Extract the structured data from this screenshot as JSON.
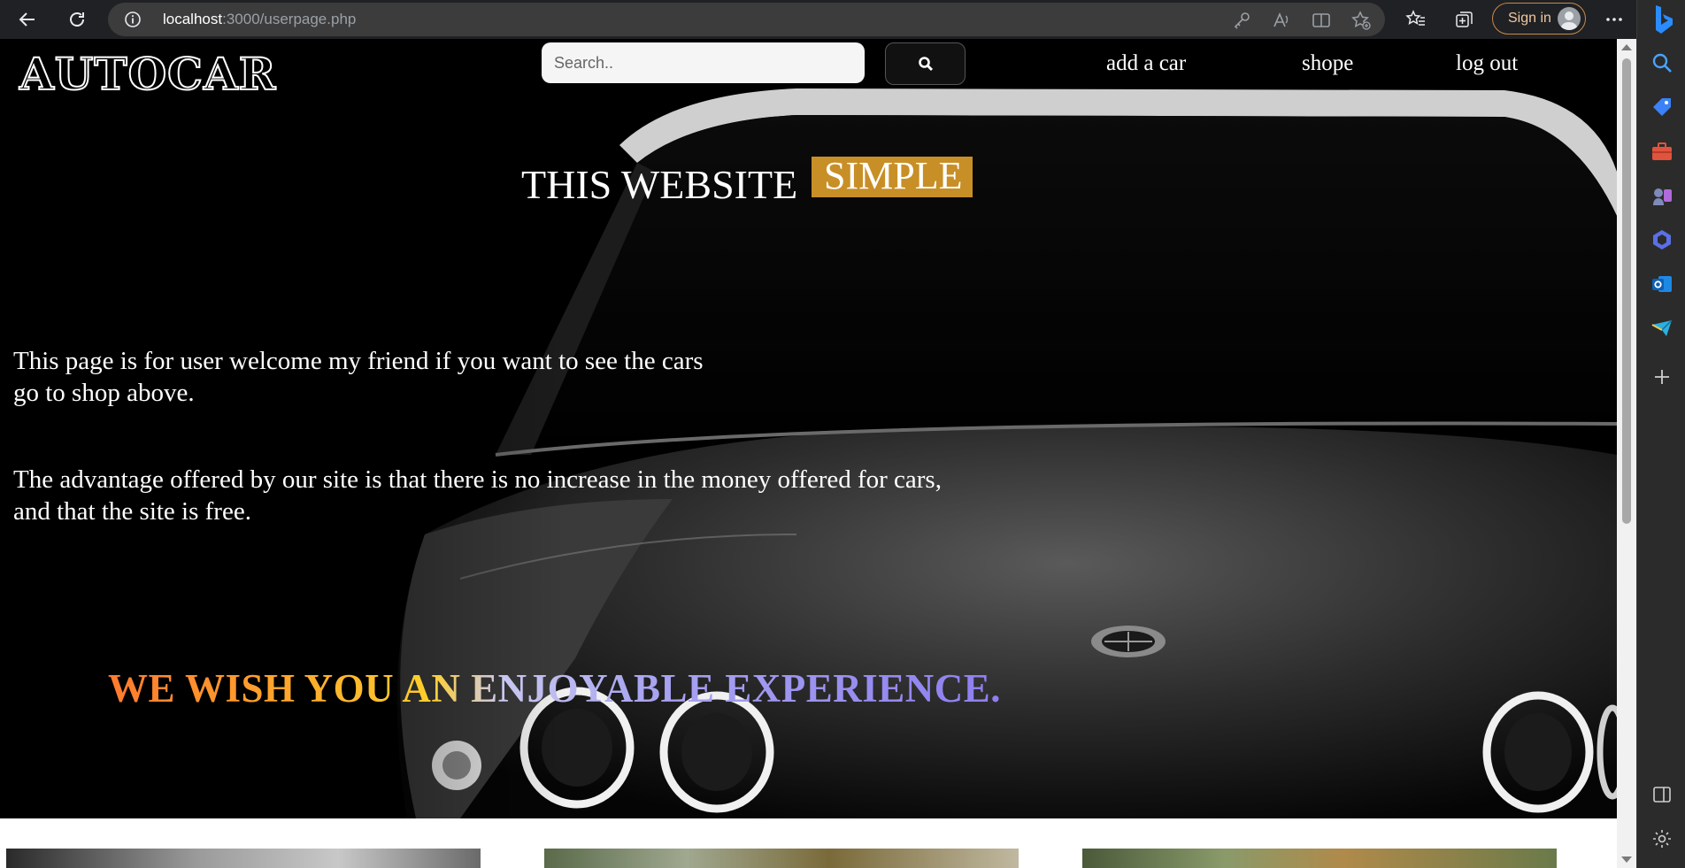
{
  "browser": {
    "url_host": "localhost",
    "url_path": ":3000/userpage.php",
    "signin_label": "Sign in"
  },
  "site": {
    "logo": "AUTOCAR",
    "search_placeholder": "Search..",
    "nav": [
      "add a car",
      "shope",
      "log out"
    ]
  },
  "hero": {
    "heading_left": "THIS WEBSITE",
    "heading_right": "SIMPLE",
    "paragraph1_line1": "This page is for user welcome my friend if you want to see the cars",
    "paragraph1_line2": "go to shop above.",
    "paragraph2_line1": "The advantage offered by our site is that there is no increase in the money offered for cars,",
    "paragraph2_line2": "and that the site is free.",
    "wish": "WE WISH YOU AN ENJOYABLE EXPERIENCE."
  },
  "icons": {
    "toolbar": [
      "back-icon",
      "refresh-icon",
      "info-icon",
      "key-icon",
      "read-aloud-icon",
      "split-screen-icon",
      "add-favorite-icon",
      "favorites-icon",
      "collections-icon",
      "more-icon"
    ],
    "sidebar": [
      "bing-icon",
      "search-icon",
      "shopping-icon",
      "tools-icon",
      "games-icon",
      "microsoft365-icon",
      "outlook-icon",
      "drop-icon",
      "add-icon",
      "sidebar-toggle-icon",
      "settings-icon"
    ]
  },
  "colors": {
    "accent_simple": "#c88f27",
    "gradient_warm": "#ff7a2f",
    "gradient_cool": "#8d7ef0"
  }
}
